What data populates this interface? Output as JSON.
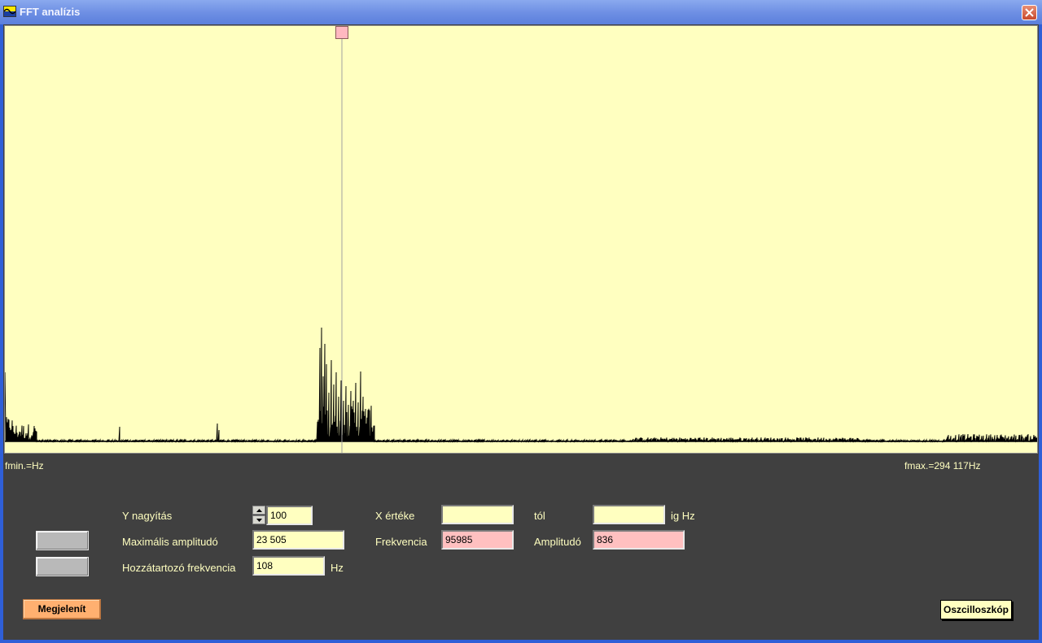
{
  "window": {
    "title": "FFT analízis"
  },
  "colors": {
    "plot_background": "#ffffc0",
    "spectrum_line": "#000000",
    "cursor_line": "#a0a0a0",
    "cursor_handle": "#ffb8c0",
    "panel_background": "#404040",
    "label_text": "#ffffc0",
    "input_background": "#ffffc0",
    "readout_background": "#ffc0c0",
    "show_button": "#ffb070"
  },
  "plot": {
    "fmin_label": "fmin.=Hz",
    "fmax_label": "fmax.=294 117Hz",
    "cursor_frequency": 95985
  },
  "controls": {
    "y_zoom_label": "Y nagyítás",
    "y_zoom_value": "100",
    "max_amplitude_label": "Maximális amplitudó",
    "max_amplitude_value": "23 505",
    "assoc_frequency_label": "Hozzátartozó frekvencia",
    "assoc_frequency_value": "108",
    "assoc_frequency_unit": "Hz",
    "x_value_label": "X értéke",
    "x_value_value": "",
    "from_label": "tól",
    "from_value": "",
    "to_unit_label": "ig Hz",
    "frequency_label": "Frekvencia",
    "frequency_value": "95985",
    "amplitude_label": "Amplitudó",
    "amplitude_value": "836"
  },
  "buttons": {
    "show_label": "Megjelenít",
    "oscilloscope_label": "Oszcilloszkóp"
  },
  "icons": {
    "app": "wave-icon",
    "close": "close-icon",
    "spin_up": "arrow-up-icon",
    "spin_down": "arrow-down-icon"
  }
}
